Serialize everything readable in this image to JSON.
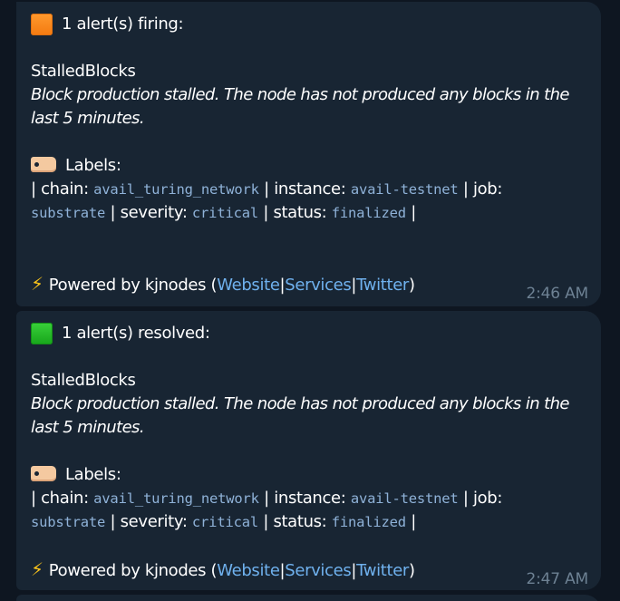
{
  "messages": [
    {
      "status_icon": "orange-square",
      "status_color": "#f47a10",
      "header": "1 alert(s) firing:",
      "alert_name": "StalledBlocks",
      "description_line1": "Block production stalled. The node has not produced any blocks in the",
      "description_line2": "last 5 minutes.",
      "labels_title": "Labels:",
      "chain_label": "| chain: ",
      "chain_value": "avail_turing_network",
      "instance_label": " | instance: ",
      "instance_value": "avail-testnet",
      "job_label": " | job:",
      "job_value": "substrate",
      "severity_label": " | severity: ",
      "severity_value": "critical",
      "status_label": " | status: ",
      "status_value": "finalized",
      "end_sep": " |",
      "powered_by": "Powered by kjnodes (",
      "link_website": "Website",
      "link_services": "Services",
      "link_twitter": "Twitter",
      "sep": "|",
      "close_paren": ")",
      "time": "2:46 AM"
    },
    {
      "status_icon": "green-square",
      "status_color": "#17a51b",
      "header": "1 alert(s) resolved:",
      "alert_name": "StalledBlocks",
      "description_line1": "Block production stalled. The node has not produced any blocks in the",
      "description_line2": "last 5 minutes.",
      "labels_title": "Labels:",
      "chain_label": "| chain: ",
      "chain_value": "avail_turing_network",
      "instance_label": " | instance: ",
      "instance_value": "avail-testnet",
      "job_label": " | job:",
      "job_value": "substrate",
      "severity_label": " | severity: ",
      "severity_value": "critical",
      "status_label": " | status: ",
      "status_value": "finalized",
      "end_sep": " |",
      "powered_by": "Powered by kjnodes (",
      "link_website": "Website",
      "link_services": "Services",
      "link_twitter": "Twitter",
      "sep": "|",
      "close_paren": ")",
      "time": "2:47 AM"
    }
  ],
  "colors": {
    "background": "#0e1621",
    "bubble": "#182533",
    "link": "#6fb1ee",
    "code": "#8fb2d8",
    "timestamp": "#6d8193"
  }
}
